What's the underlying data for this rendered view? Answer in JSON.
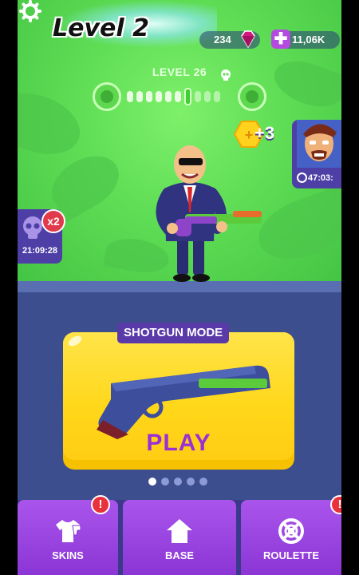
{
  "overlay_title": "Level 2",
  "hud": {
    "cash": "234",
    "plus_currency": "11,06K",
    "gem_icon": "gem-icon",
    "settings_icon": "gear-icon"
  },
  "level": {
    "label": "LEVEL 26",
    "stage_count": 10,
    "current_stage": 6
  },
  "reward": {
    "amount": "+3"
  },
  "boss": {
    "timer": "47:03:"
  },
  "skull_event": {
    "multiplier": "x2",
    "timer": "21:09:28"
  },
  "mode_card": {
    "title": "SHOTGUN MODE",
    "action": "PLAY"
  },
  "pager": {
    "pages": 5,
    "active": 0
  },
  "nav": {
    "tabs": [
      {
        "label": "SKINS",
        "icon": "shirt-icon",
        "alert": "!"
      },
      {
        "label": "BASE",
        "icon": "house-icon"
      },
      {
        "label": "ROULETTE",
        "icon": "roulette-icon",
        "alert": "!"
      }
    ]
  },
  "colors": {
    "sky": "#5fdd55",
    "card": "#ffd719",
    "play_text": "#9a2fd6",
    "nav_tab": "#9a44e0",
    "alert": "#e8313b"
  }
}
